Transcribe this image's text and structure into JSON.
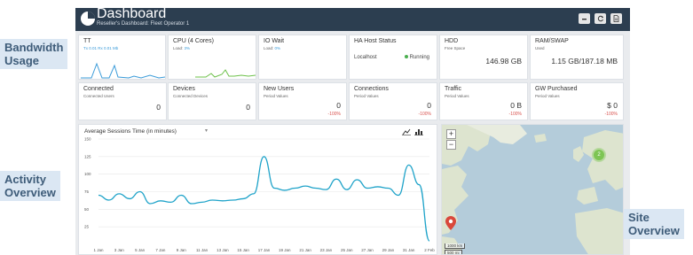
{
  "header": {
    "title": "Dashboard",
    "subtitle": "Reseller's Dashboard: Fleet Operator 1",
    "buttons": [
      "minimize-icon",
      "refresh-icon",
      "export-icon"
    ]
  },
  "callouts": {
    "bandwidth": [
      "Bandwidth",
      "Usage"
    ],
    "activity": [
      "Activity",
      "Overview"
    ],
    "site": [
      "Site",
      "Overview"
    ]
  },
  "cards_row1": {
    "bandwidth": {
      "title": "TT",
      "sub": "Tx 0.01 Rx 0.01 Mb"
    },
    "cpu": {
      "title": "CPU (4 Cores)",
      "sub_label": "Load:",
      "sub_value": "3%"
    },
    "iowait": {
      "title": "IO Wait",
      "sub_label": "Load:",
      "sub_value": "0%"
    },
    "ha": {
      "title": "HA Host Status",
      "host": "Localhost",
      "status": "Running"
    },
    "hdd": {
      "title": "HDD",
      "sub": "Free Space",
      "value": "146.98 GB"
    },
    "ram": {
      "title": "RAM/SWAP",
      "sub": "Used",
      "value": "1.15 GB/187.18 MB"
    }
  },
  "cards_row2": {
    "connected": {
      "title": "Connected",
      "sub": "Connected Users",
      "value": "0"
    },
    "devices": {
      "title": "Devices",
      "sub": "Connected Devices",
      "value": "0"
    },
    "new_users": {
      "title": "New Users",
      "sub": "Period Values",
      "value": "0",
      "change": "-100%"
    },
    "connections": {
      "title": "Connections",
      "sub": "Period Values",
      "value": "0",
      "change": "-100%"
    },
    "traffic": {
      "title": "Traffic",
      "sub": "Period Values",
      "value": "0 B",
      "change": "-100%"
    },
    "gw": {
      "title": "GW Purchased",
      "sub": "Period Values",
      "value": "$ 0",
      "change": "-100%"
    }
  },
  "activity": {
    "title": "Average Sessions Time (in minutes)"
  },
  "chart_data": {
    "type": "line",
    "title": "Average Sessions Time (in minutes)",
    "x": [
      "1 Jan",
      "2 Jan",
      "3 Jan",
      "4 Jan",
      "5 Jan",
      "6 Jan",
      "7 Jan",
      "8 Jan",
      "9 Jan",
      "10 Jan",
      "11 Jan",
      "12 Jan",
      "13 Jan",
      "14 Jan",
      "15 Jan",
      "16 Jan",
      "17 Jan",
      "18 Jan",
      "19 Jan",
      "20 Jan",
      "21 Jan",
      "22 Jan",
      "23 Jan",
      "24 Jan",
      "25 Jan",
      "26 Jan",
      "27 Jan",
      "28 Jan",
      "29 Jan",
      "30 Jan",
      "31 Jan",
      "1 Feb",
      "2 Feb"
    ],
    "xticks": [
      "1 Jan",
      "3 Jan",
      "5 Jan",
      "7 Jan",
      "9 Jan",
      "11 Jan",
      "13 Jan",
      "15 Jan",
      "17 Jan",
      "19 Jan",
      "21 Jan",
      "23 Jan",
      "25 Jan",
      "27 Jan",
      "29 Jan",
      "31 Jan",
      "2 Feb"
    ],
    "y": [
      70,
      63,
      72,
      65,
      75,
      58,
      62,
      60,
      70,
      58,
      60,
      63,
      62,
      63,
      65,
      72,
      125,
      80,
      77,
      80,
      83,
      80,
      78,
      93,
      78,
      92,
      80,
      82,
      80,
      70,
      113,
      85,
      5
    ],
    "yticks": [
      150,
      125,
      100,
      75,
      50,
      25
    ],
    "ylim": [
      0,
      150
    ],
    "grid": true
  },
  "map": {
    "zoom_in": "+",
    "zoom_out": "−",
    "cluster_count": "2",
    "scale_km": "1000 km",
    "scale_mi": "500 mi",
    "colors": {
      "land": "#dde4cf",
      "sea": "#b4ccda",
      "cluster": "#7dc553",
      "marker": "#d9483b"
    }
  }
}
